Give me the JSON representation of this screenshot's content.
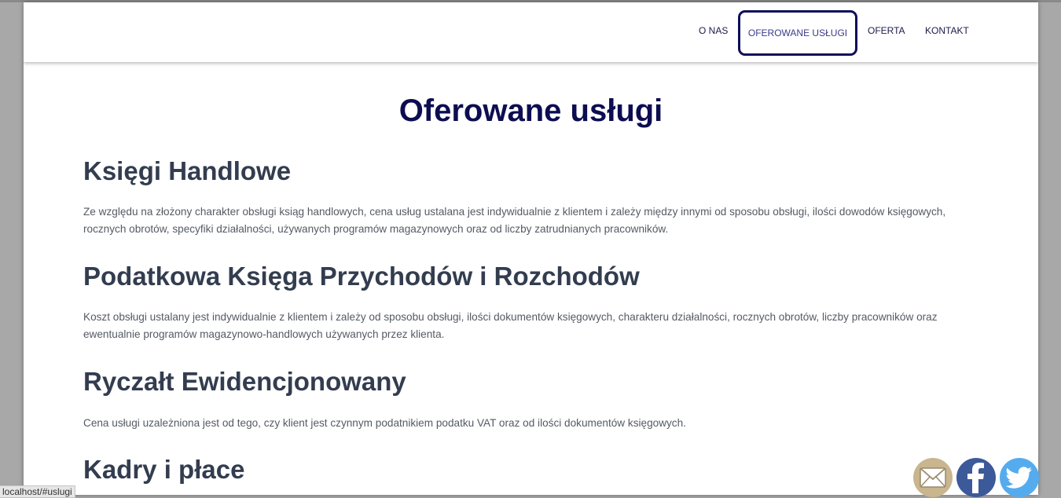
{
  "nav": {
    "items": [
      {
        "label": "O NAS"
      },
      {
        "label": "OFEROWANE USŁUGI"
      },
      {
        "label": "OFERTA"
      },
      {
        "label": "KONTAKT"
      }
    ],
    "active_index": 1
  },
  "main": {
    "title": "Oferowane usługi",
    "sections": [
      {
        "heading": "Księgi Handlowe",
        "text": "Ze względu na złożony charakter obsługi ksiąg handlowych, cena usług ustalana jest indywidualnie z klientem i zależy między innymi od sposobu obsługi, ilości dowodów księgowych, rocznych obrotów, specyfiki działalności, używanych programów magazynowych oraz od liczby zatrudnianych pracowników."
      },
      {
        "heading": "Podatkowa Księga Przychodów i Rozchodów",
        "text": "Koszt obsługi ustalany jest indywidualnie z klientem i zależy od sposobu obsługi, ilości dokumentów księgowych, charakteru działalności, rocznych obrotów, liczby pracowników oraz ewentualnie programów magazynowo-handlowych używanych przez klienta."
      },
      {
        "heading": "Ryczałt Ewidencjonowany",
        "text": "Cena usługi uzależniona jest od tego, czy klient jest czynnym podatnikiem podatku VAT oraz od ilości dokumentów księgowych."
      },
      {
        "heading": "Kadry i płace",
        "text": ""
      }
    ]
  },
  "social": [
    {
      "icon": "email-icon",
      "color": "#c9b58e"
    },
    {
      "icon": "facebook-icon",
      "color": "#3c5a9a"
    },
    {
      "icon": "twitter-icon",
      "color": "#54acee"
    }
  ],
  "status_bar": {
    "url": "localhost/#uslugi"
  },
  "colors": {
    "title": "#0d0d52",
    "heading": "#333d4f",
    "active_border": "#0e0e5a"
  }
}
